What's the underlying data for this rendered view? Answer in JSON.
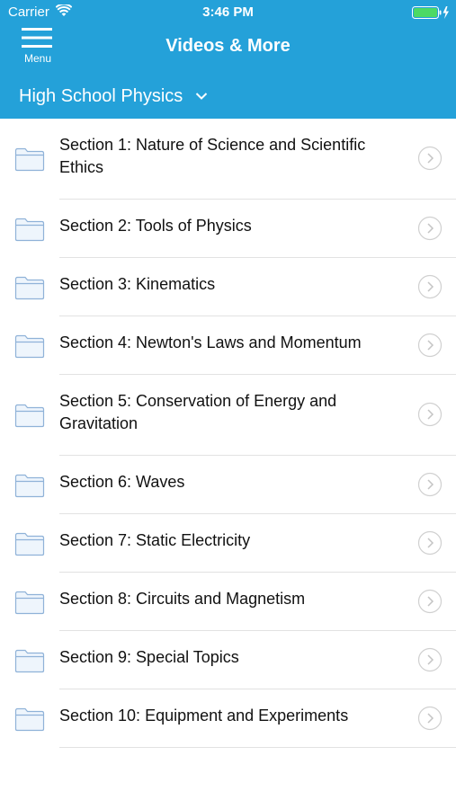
{
  "status_bar": {
    "carrier": "Carrier",
    "time": "3:46 PM",
    "wifi_icon": "wifi-icon",
    "battery_icon": "battery-charging-icon"
  },
  "header": {
    "menu_label": "Menu",
    "menu_icon": "hamburger-icon",
    "title": "Videos & More",
    "course": "High School Physics",
    "course_icon": "chevron-down-icon",
    "background_color": "#24a1d9"
  },
  "sections": [
    {
      "label": "Section 1: Nature of Science and Scientific Ethics"
    },
    {
      "label": "Section 2: Tools of Physics"
    },
    {
      "label": "Section 3: Kinematics"
    },
    {
      "label": "Section 4: Newton's Laws and Momentum"
    },
    {
      "label": "Section 5: Conservation of Energy and Gravitation"
    },
    {
      "label": "Section 6: Waves"
    },
    {
      "label": "Section 7: Static Electricity"
    },
    {
      "label": "Section 8: Circuits and Magnetism"
    },
    {
      "label": "Section 9: Special Topics"
    },
    {
      "label": "Section 10: Equipment and Experiments"
    }
  ],
  "row_icons": {
    "leading": "folder-icon",
    "trailing": "chevron-right-circle-icon"
  }
}
